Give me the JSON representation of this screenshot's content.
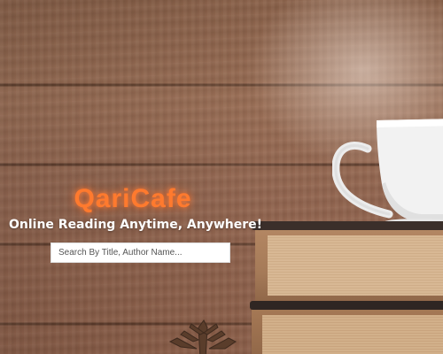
{
  "hero": {
    "brand": "QariCafe",
    "tagline": "Online Reading Anytime, Anywhere!"
  },
  "search": {
    "value": "",
    "placeholder": "Search By Title, Author Name..."
  },
  "colors": {
    "brand_accent": "#ff7a2e",
    "tagline_text": "#ffffff",
    "search_background": "#ffffff"
  },
  "images": {
    "background": "wooden-wall-background",
    "decor": [
      "coffee-cup-image",
      "stacked-books-image",
      "pine-cone-image"
    ]
  }
}
